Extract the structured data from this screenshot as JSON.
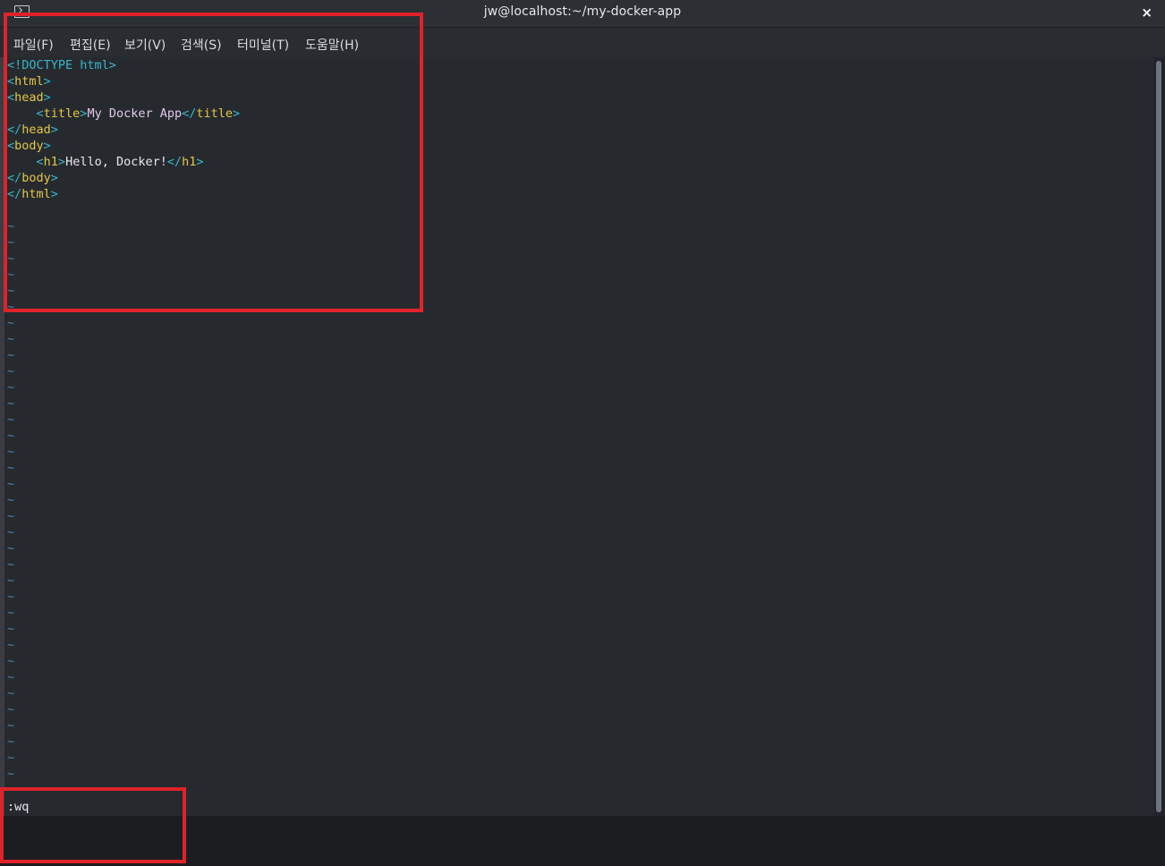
{
  "window": {
    "title": "jw@localhost:~/my-docker-app",
    "close_symbol": "×",
    "icon": "terminal-icon"
  },
  "menu": [
    {
      "label": "파일(F)"
    },
    {
      "label": "편집(E)"
    },
    {
      "label": "보기(V)"
    },
    {
      "label": "검색(S)"
    },
    {
      "label": "터미널(T)"
    },
    {
      "label": "도움말(H)"
    }
  ],
  "editor": {
    "lines": [
      [
        {
          "t": "<!DOCTYPE html>",
          "c": "#38b6c9"
        }
      ],
      [
        {
          "t": "<",
          "c": "#38b6c9"
        },
        {
          "t": "html",
          "c": "#e5c644"
        },
        {
          "t": ">",
          "c": "#38b6c9"
        }
      ],
      [
        {
          "t": "<",
          "c": "#38b6c9"
        },
        {
          "t": "head",
          "c": "#e5c644"
        },
        {
          "t": ">",
          "c": "#38b6c9"
        }
      ],
      [
        {
          "t": "    ",
          "c": "#e8e8e8"
        },
        {
          "t": "<",
          "c": "#38b6c9"
        },
        {
          "t": "title",
          "c": "#e5c644"
        },
        {
          "t": ">",
          "c": "#38b6c9"
        },
        {
          "t": "My Docker App",
          "c": "#e3c9e8"
        },
        {
          "t": "</",
          "c": "#38b6c9"
        },
        {
          "t": "title",
          "c": "#e5c644"
        },
        {
          "t": ">",
          "c": "#38b6c9"
        }
      ],
      [
        {
          "t": "</",
          "c": "#38b6c9"
        },
        {
          "t": "head",
          "c": "#e5c644"
        },
        {
          "t": ">",
          "c": "#38b6c9"
        }
      ],
      [
        {
          "t": "<",
          "c": "#38b6c9"
        },
        {
          "t": "body",
          "c": "#e5c644"
        },
        {
          "t": ">",
          "c": "#38b6c9"
        }
      ],
      [
        {
          "t": "    ",
          "c": "#e8e8e8"
        },
        {
          "t": "<",
          "c": "#38b6c9"
        },
        {
          "t": "h1",
          "c": "#e5c644"
        },
        {
          "t": ">",
          "c": "#38b6c9"
        },
        {
          "t": "Hello, Docker!",
          "c": "#e8e8e8"
        },
        {
          "t": "</",
          "c": "#38b6c9"
        },
        {
          "t": "h1",
          "c": "#e5c644"
        },
        {
          "t": ">",
          "c": "#38b6c9"
        }
      ],
      [
        {
          "t": "</",
          "c": "#38b6c9"
        },
        {
          "t": "body",
          "c": "#e5c644"
        },
        {
          "t": ">",
          "c": "#38b6c9"
        }
      ],
      [
        {
          "t": "</",
          "c": "#38b6c9"
        },
        {
          "t": "html",
          "c": "#e5c644"
        },
        {
          "t": ">",
          "c": "#38b6c9"
        }
      ]
    ],
    "tilde_char": "~",
    "tilde_count": 35,
    "command": ":wq"
  },
  "colors": {
    "highlight": "#e0222a",
    "tag_bracket": "#38b6c9",
    "tag_name": "#e5c644",
    "tilde": "#4f7ea8"
  }
}
